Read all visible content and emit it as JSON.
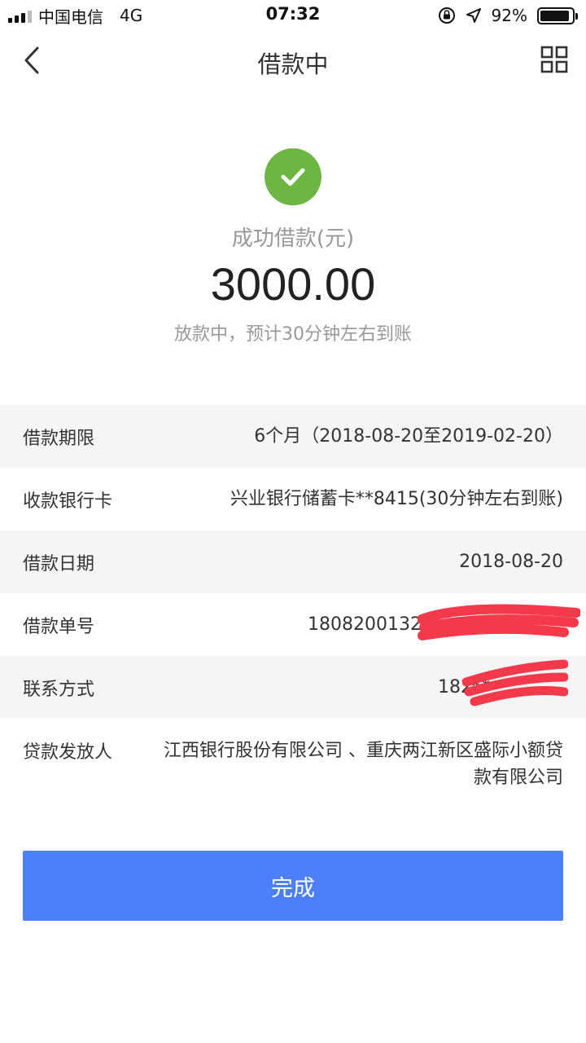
{
  "status_bar": {
    "carrier": "中国电信",
    "network": "4G",
    "time": "07:32",
    "battery_percent": "92%",
    "battery_level": 0.92
  },
  "nav": {
    "title": "借款中",
    "back_icon": "chevron-left-icon",
    "right_icon": "grid-icon"
  },
  "success": {
    "icon": "check-circle-icon",
    "icon_color": "#6cb743",
    "label": "成功借款(元)",
    "amount": "3000.00",
    "hint": "放款中，预计30分钟左右到账"
  },
  "details": {
    "rows": [
      {
        "label": "借款期限",
        "value": "6个月（2018-08-20至2019-02-20）"
      },
      {
        "label": "收款银行卡",
        "value": "兴业银行储蓄卡**8415(30分钟左右到账)"
      },
      {
        "label": "借款日期",
        "value": "2018-08-20"
      },
      {
        "label": "借款单号",
        "value": "18082001327"
      },
      {
        "label": "联系方式",
        "value": "182**"
      },
      {
        "label": "贷款发放人",
        "value": "江西银行股份有限公司 、重庆两江新区盛际小额贷款有限公司"
      }
    ]
  },
  "button": {
    "label": "完成",
    "color": "#4d7ffb"
  }
}
